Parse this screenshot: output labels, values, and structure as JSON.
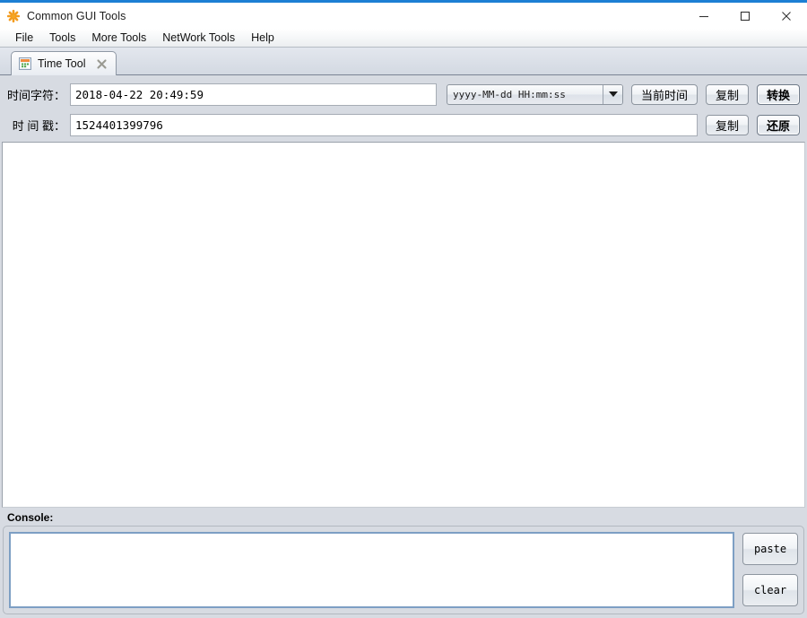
{
  "window": {
    "title": "Common GUI Tools",
    "app_icon": "asterisk-icon",
    "accent_color": "#1c7fd4",
    "controls": {
      "minimize": "minimize-icon",
      "maximize": "maximize-icon",
      "close": "close-icon"
    }
  },
  "menubar": {
    "items": [
      {
        "label": "File"
      },
      {
        "label": "Tools"
      },
      {
        "label": "More Tools"
      },
      {
        "label": "NetWork Tools"
      },
      {
        "label": "Help"
      }
    ]
  },
  "tabs": [
    {
      "label": "Time Tool",
      "icon": "calendar-icon",
      "close_icon": "close-icon",
      "active": true
    }
  ],
  "form": {
    "time_string": {
      "label": "时间字符：",
      "value": "2018-04-22 20:49:59",
      "placeholder": ""
    },
    "format_select": {
      "value": "yyyy-MM-dd HH:mm:ss",
      "arrow_icon": "chevron-down-icon"
    },
    "now_button": "当前时间",
    "copy_button_1": "复制",
    "convert_button": "转换",
    "timestamp": {
      "label": "时 间 戳：",
      "value": "1524401399796",
      "placeholder": ""
    },
    "copy_button_2": "复制",
    "restore_button": "还原"
  },
  "output": {
    "content": ""
  },
  "console": {
    "label": "Console:",
    "content": "",
    "placeholder": "",
    "paste_button": "paste",
    "clear_button": "clear"
  }
}
